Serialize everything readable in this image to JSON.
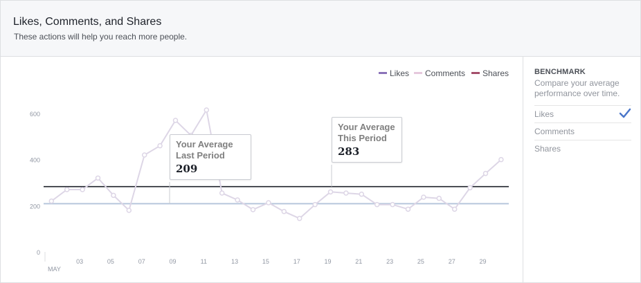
{
  "header": {
    "title": "Likes, Comments, and Shares",
    "subtitle": "These actions will help you reach more people."
  },
  "legend": [
    {
      "label": "Likes",
      "color": "#8b73b9"
    },
    {
      "label": "Comments",
      "color": "#e6c8dc"
    },
    {
      "label": "Shares",
      "color": "#a44f6b"
    }
  ],
  "benchmark": {
    "title": "BENCHMARK",
    "description": "Compare your average performance over time.",
    "options": [
      {
        "label": "Likes",
        "selected": true
      },
      {
        "label": "Comments",
        "selected": false
      },
      {
        "label": "Shares",
        "selected": false
      }
    ],
    "check_color": "#4a76c9"
  },
  "tooltips": {
    "last_period": {
      "label_line1": "Your Average",
      "label_line2": "Last Period",
      "value": "209"
    },
    "this_period": {
      "label_line1": "Your Average",
      "label_line2": "This Period",
      "value": "283"
    }
  },
  "chart_data": {
    "type": "line",
    "x_labels": [
      "03",
      "05",
      "07",
      "09",
      "11",
      "13",
      "15",
      "17",
      "19",
      "21",
      "23",
      "25",
      "27",
      "29"
    ],
    "x_sub_label": "MAY",
    "y_ticks": [
      0,
      200,
      400,
      600
    ],
    "ylim": [
      0,
      600
    ],
    "x": [
      1,
      2,
      3,
      4,
      5,
      6,
      7,
      8,
      9,
      10,
      11,
      12,
      13,
      14,
      15,
      16,
      17,
      18,
      19,
      20,
      21,
      22,
      23,
      24,
      25,
      26,
      27,
      28,
      29,
      30
    ],
    "series": [
      {
        "name": "Likes",
        "color": "#ddd6e6",
        "values": [
          220,
          270,
          270,
          320,
          245,
          180,
          420,
          460,
          570,
          505,
          615,
          255,
          225,
          183,
          213,
          175,
          145,
          205,
          260,
          255,
          250,
          205,
          205,
          185,
          237,
          232,
          185,
          278,
          340,
          400
        ]
      }
    ],
    "reference_lines": [
      {
        "label": "Your Average Last Period",
        "value": 209,
        "color": "#b7c7dc"
      },
      {
        "label": "Your Average This Period",
        "value": 283,
        "color": "#1d2129"
      }
    ],
    "grid": false
  }
}
